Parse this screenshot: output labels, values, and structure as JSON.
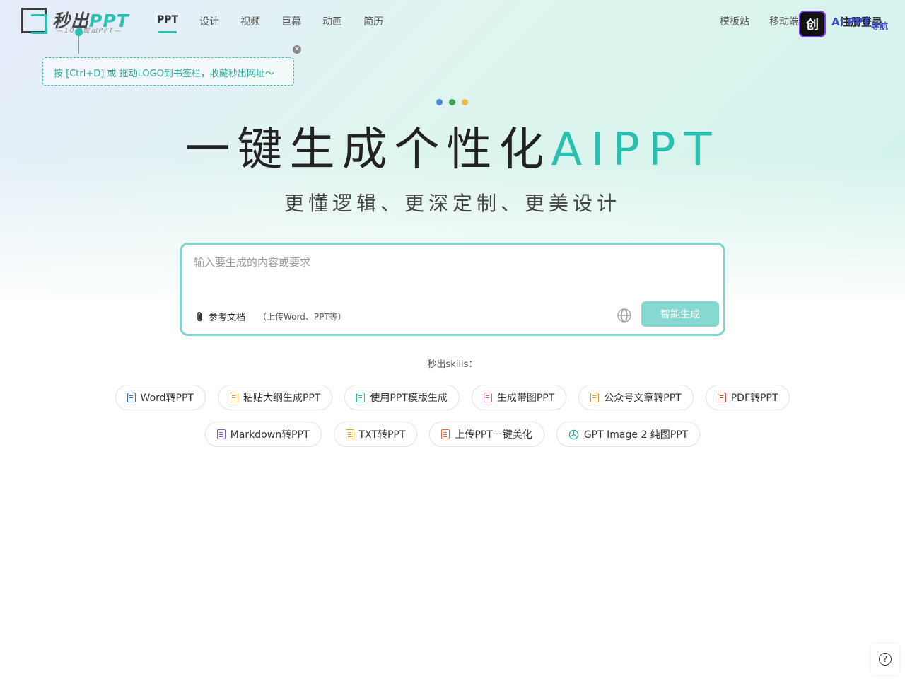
{
  "header": {
    "logo_text": "秒出",
    "logo_ppt": "PPT",
    "logo_slogan": "—10秒做出PPT—",
    "nav": [
      {
        "label": "PPT",
        "active": true
      },
      {
        "label": "设计"
      },
      {
        "label": "视频"
      },
      {
        "label": "巨幕"
      },
      {
        "label": "动画"
      },
      {
        "label": "简历"
      }
    ],
    "right_nav": [
      {
        "label": "模板站"
      },
      {
        "label": "移动端"
      }
    ],
    "login_label": "注册登录",
    "badge_glyph": "创",
    "badge_text": "AI PPT",
    "badge_sub": "导航"
  },
  "tooltip": {
    "text": "按 [Ctrl+D] 或 拖动LOGO到书签栏，收藏秒出网址～",
    "close_glyph": "✕"
  },
  "hero": {
    "dot_colors": [
      "#4a86e8",
      "#34a853",
      "#f4b942"
    ],
    "title_main": "一键生成个性化",
    "title_accent": "AIPPT",
    "subtitle": "更懂逻辑、更深定制、更美设计"
  },
  "input": {
    "placeholder": "输入要生成的内容或要求",
    "value": "",
    "attach_label": "参考文档",
    "attach_hint": "（上传Word、PPT等）",
    "generate_label": "智能生成"
  },
  "skills": {
    "label": "秒出skills：",
    "row1": [
      {
        "label": "Word转PPT",
        "icon": "word-file-icon",
        "color": "#3b73c9"
      },
      {
        "label": "粘贴大纲生成PPT",
        "icon": "outline-file-icon",
        "color": "#e0a030"
      },
      {
        "label": "使用PPT模版生成",
        "icon": "template-icon",
        "color": "#2bbfb0"
      },
      {
        "label": "生成带图PPT",
        "icon": "image-file-icon",
        "color": "#d066b0"
      },
      {
        "label": "公众号文章转PPT",
        "icon": "article-file-icon",
        "color": "#e0a030"
      },
      {
        "label": "PDF转PPT",
        "icon": "pdf-file-icon",
        "color": "#e04b4b"
      }
    ],
    "row2": [
      {
        "label": "Markdown转PPT",
        "icon": "markdown-file-icon",
        "color": "#7a5cc7"
      },
      {
        "label": "TXT转PPT",
        "icon": "txt-file-icon",
        "color": "#e0a030"
      },
      {
        "label": "上传PPT一键美化",
        "icon": "ppt-file-icon",
        "color": "#e06a3b"
      },
      {
        "label": "GPT Image 2 纯图PPT",
        "icon": "openai-icon",
        "color": "#2aa89b"
      }
    ]
  },
  "help_glyph": "?"
}
